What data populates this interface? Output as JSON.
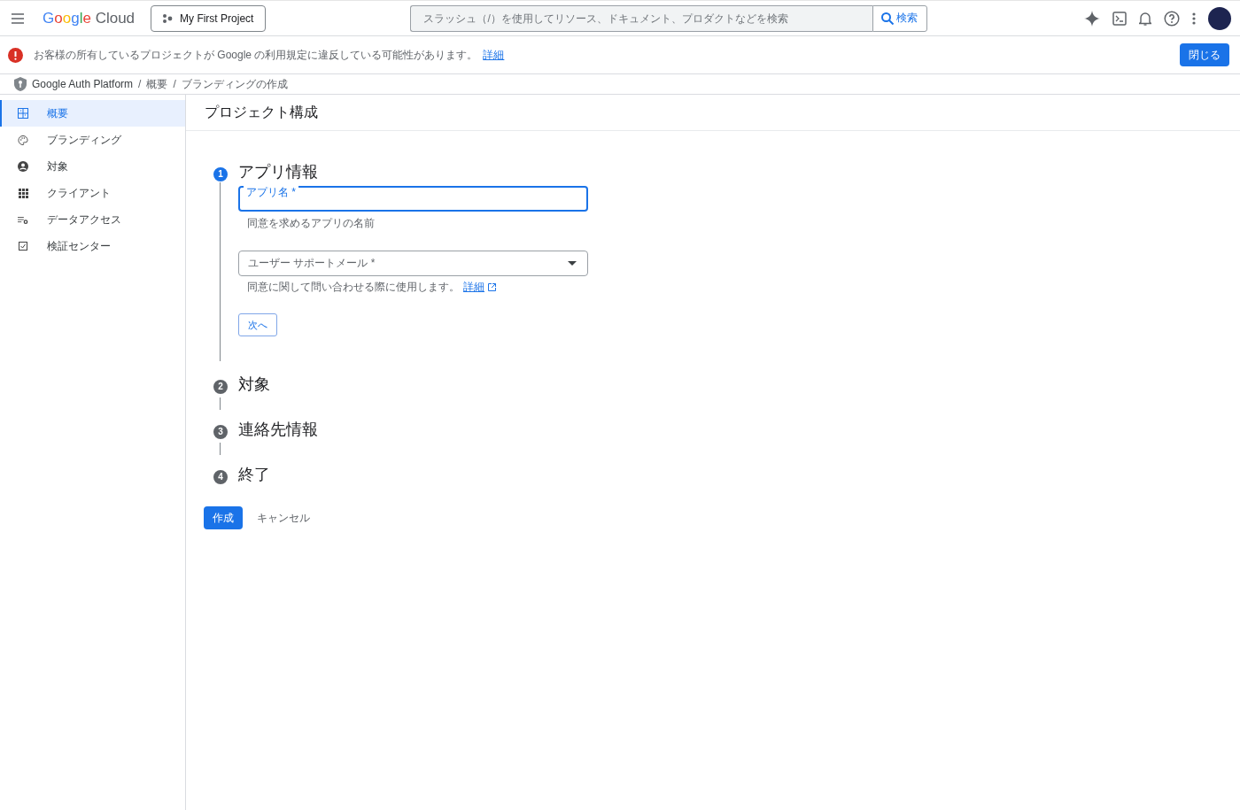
{
  "header": {
    "logo": {
      "brand": "Google",
      "product": "Cloud"
    },
    "project": "My First Project",
    "search": {
      "placeholder": "スラッシュ（/）を使用してリソース、ドキュメント、プロダクトなどを検索",
      "button": "検索"
    }
  },
  "banner": {
    "message": "お客様の所有しているプロジェクトが Google の利用規定に違反している可能性があります。",
    "link": "詳細",
    "close": "閉じる"
  },
  "breadcrumbs": {
    "separator": "/",
    "items": [
      "Google Auth Platform",
      "概要",
      "ブランディングの作成"
    ]
  },
  "sidebar": {
    "items": [
      {
        "label": "概要",
        "selected": true
      },
      {
        "label": "ブランディング",
        "selected": false
      },
      {
        "label": "対象",
        "selected": false
      },
      {
        "label": "クライアント",
        "selected": false
      },
      {
        "label": "データアクセス",
        "selected": false
      },
      {
        "label": "検証センター",
        "selected": false
      }
    ]
  },
  "page_title": "プロジェクト構成",
  "steps": [
    {
      "number": "1",
      "title": "アプリ情報",
      "selected": true
    },
    {
      "number": "2",
      "title": "対象",
      "selected": false
    },
    {
      "number": "3",
      "title": "連絡先情報",
      "selected": false
    },
    {
      "number": "4",
      "title": "終了",
      "selected": false
    }
  ],
  "form": {
    "app_name": {
      "label": "アプリ名 *",
      "hint": "同意を求めるアプリの名前",
      "focused": true
    },
    "support_email": {
      "placeholder": "ユーザー サポートメール *",
      "hint": "同意に関して問い合わせる際に使用します。",
      "link": "詳細"
    },
    "next": "次へ"
  },
  "actions": {
    "create": "作成",
    "cancel": "キャンセル"
  }
}
